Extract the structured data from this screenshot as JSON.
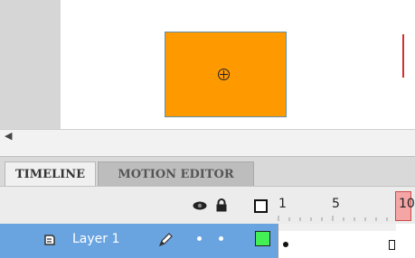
{
  "stage": {
    "shape_color": "#ff9900",
    "registration_icon": "registration-point-icon"
  },
  "scrollbar": {
    "left_arrow": "◀"
  },
  "tabs": [
    {
      "label": "TIMELINE",
      "active": true
    },
    {
      "label": "MOTION EDITOR",
      "active": false
    }
  ],
  "timeline": {
    "header_icons": [
      "eye-icon",
      "lock-icon",
      "outline-icon"
    ],
    "frame_numbers": [
      "1",
      "5",
      "10"
    ],
    "current_frame": 10,
    "playhead_color": "#d04a4a"
  },
  "layers": [
    {
      "name": "Layer 1",
      "icon": "layer-icon",
      "edit_icon": "pencil-icon",
      "outline_color": "#44ee55",
      "selected": true
    }
  ],
  "colors": {
    "layer_selected_bg": "#6aa4e0",
    "stage_bg": "#ffffff",
    "pasteboard": "#d6d6d6"
  }
}
